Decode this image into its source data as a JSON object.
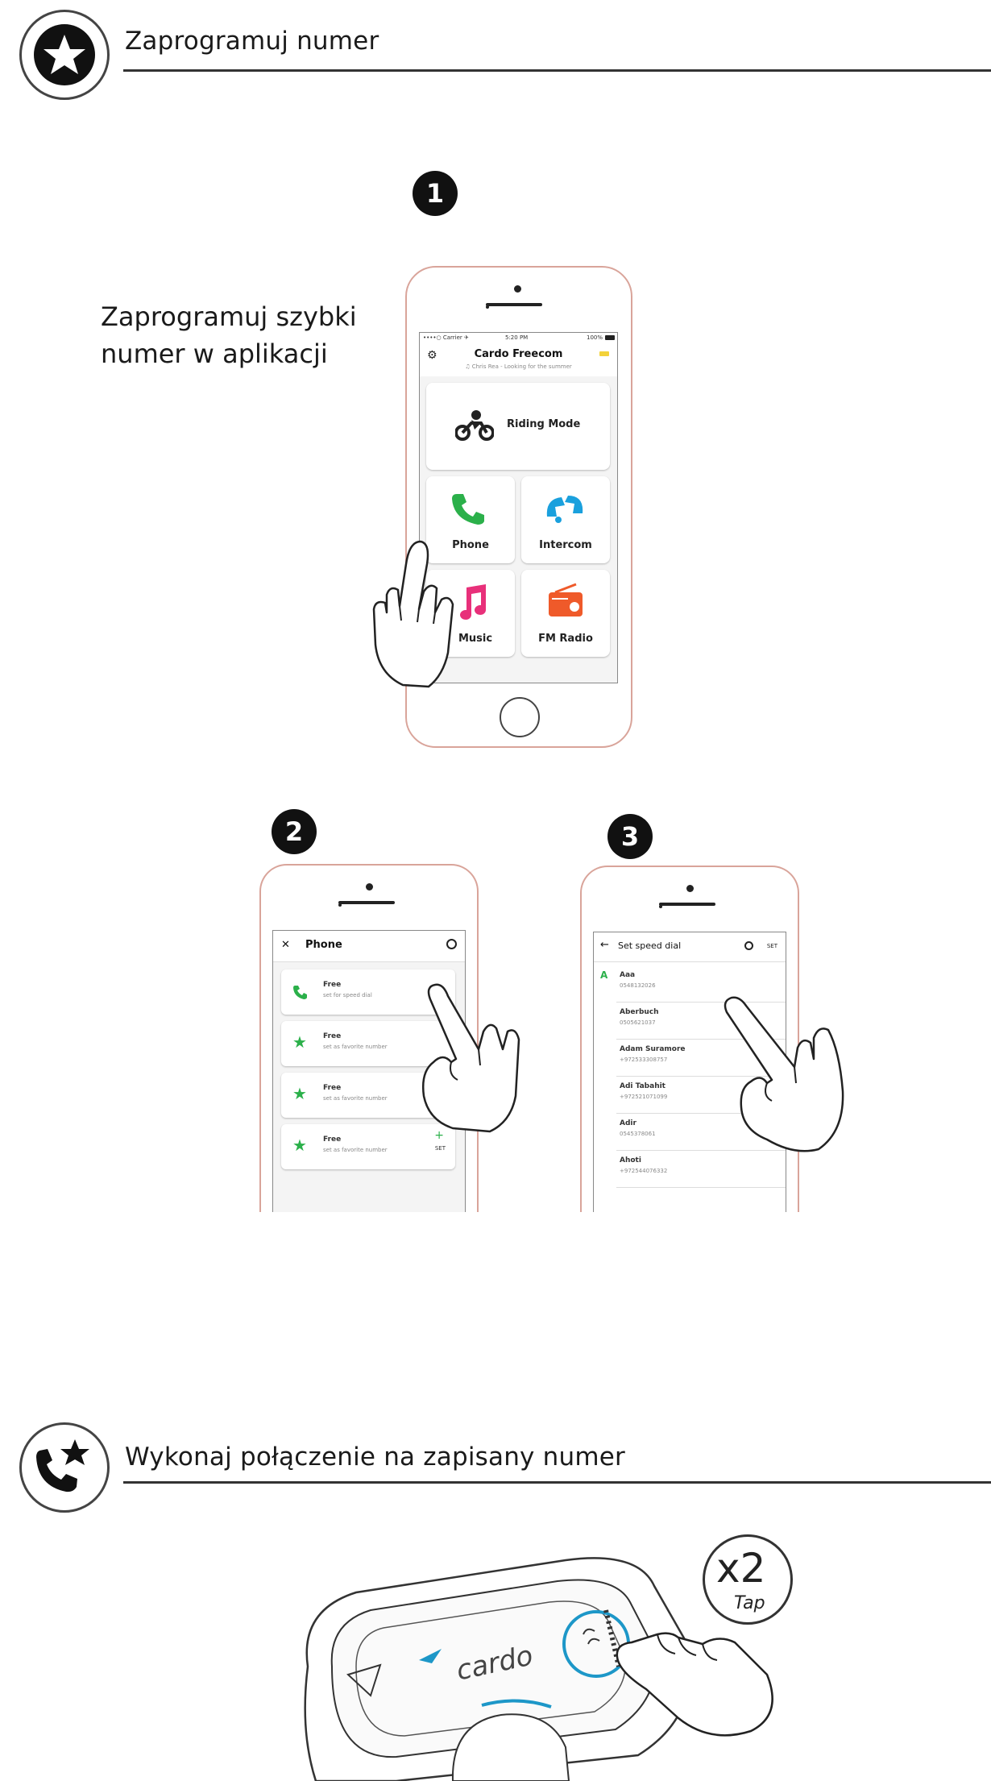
{
  "section1": {
    "title": "Zaprogramuj numer",
    "caption_line1": "Zaprogramuj szybki",
    "caption_line2": "numer w aplikacji"
  },
  "steps": [
    "1",
    "2",
    "3"
  ],
  "phone1": {
    "status_carrier": "••••○ Carrier ✈",
    "status_time": "5:20 PM",
    "status_battery": "100%",
    "app_title": "Cardo Freecom",
    "now_playing": "♫ Chris Rea - Looking for the summer",
    "tiles": {
      "riding_mode": "Riding Mode",
      "phone": "Phone",
      "intercom": "Intercom",
      "music": "Music",
      "fm_radio": "FM Radio"
    }
  },
  "phone2": {
    "close_glyph": "✕",
    "title": "Phone",
    "rows": [
      {
        "title": "Free",
        "sub": "set for speed dial"
      },
      {
        "title": "Free",
        "sub": "set as favorite number"
      },
      {
        "title": "Free",
        "sub": "set as favorite number"
      },
      {
        "title": "Free",
        "sub": "set as favorite number"
      }
    ],
    "set_label": "SET"
  },
  "phone3": {
    "back_glyph": "←",
    "title": "Set speed dial",
    "set_label": "SET",
    "index_letter": "A",
    "contacts": [
      {
        "name": "Aaa",
        "number": "0548132026"
      },
      {
        "name": "Aberbuch",
        "number": "0505621037"
      },
      {
        "name": "Adam Suramore",
        "number": "+972533308757"
      },
      {
        "name": "Adi Tabahit",
        "number": "+972521071099"
      },
      {
        "name": "Adir",
        "number": "0545378061"
      },
      {
        "name": "Ahoti",
        "number": "+972544076332"
      }
    ]
  },
  "section2": {
    "title": "Wykonaj połączenie na zapisany numer",
    "device_brand": "cardo",
    "tap_count": "x2",
    "tap_label": "Tap"
  },
  "colors": {
    "phone_green": "#2bb04a",
    "intercom_blue": "#1aa0dd",
    "music_pink": "#e8307a",
    "radio_orange": "#ef5a2a",
    "button_ring": "#1d97c8",
    "phone_frame": "#d9a49a"
  }
}
